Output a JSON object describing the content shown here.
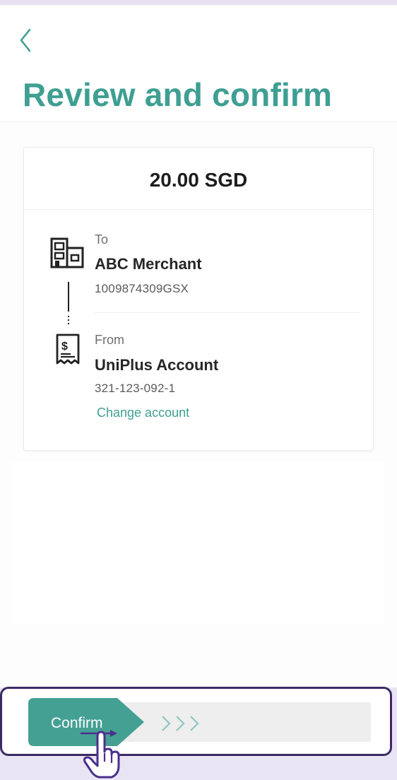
{
  "header": {
    "back_icon": "chevron-left-icon",
    "title": "Review and confirm"
  },
  "card": {
    "amount": "20.00 SGD",
    "to": {
      "icon": "building-icon",
      "label": "To",
      "name": "ABC Merchant",
      "account": "1009874309GSX"
    },
    "from": {
      "icon": "receipt-icon",
      "label": "From",
      "name": "UniPlus Account",
      "account": "321-123-092-1",
      "change_link": "Change account"
    }
  },
  "slider": {
    "label": "Confirm",
    "arrows_icon": "triple-chevron-right-icon"
  },
  "colors": {
    "accent": "#3e9f92",
    "highlight_outline": "#3b2a63",
    "annotation_arrow": "#4a2f8c"
  }
}
